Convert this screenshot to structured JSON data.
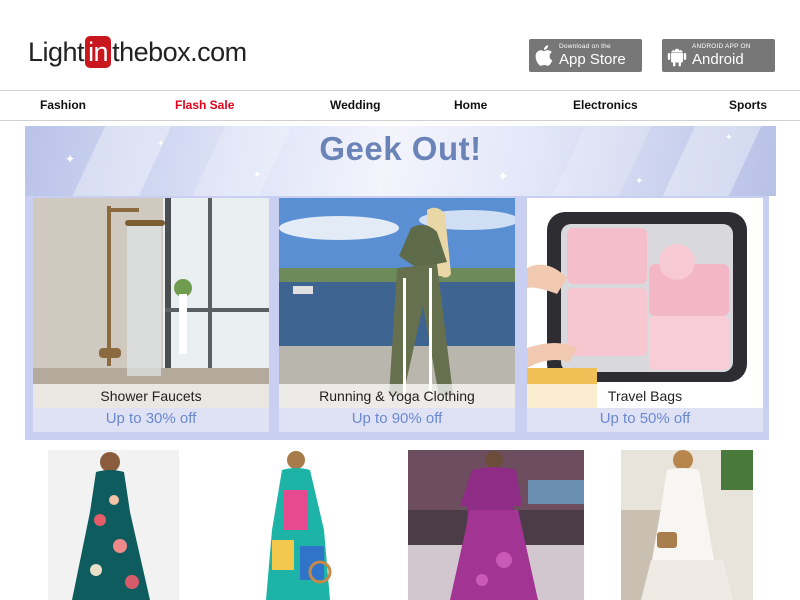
{
  "header": {
    "logo": {
      "pre": "Light",
      "mid": "in",
      "post": "thebox",
      "suffix": ".com"
    },
    "app_store": {
      "small": "Download on the",
      "big": "App Store",
      "icon": "apple-icon"
    },
    "android": {
      "small": "ANDROID APP ON",
      "big": "Android",
      "icon": "android-icon"
    }
  },
  "nav": {
    "items": [
      {
        "label": "Fashion"
      },
      {
        "label": "Flash Sale",
        "highlight": true
      },
      {
        "label": "Wedding"
      },
      {
        "label": "Home"
      },
      {
        "label": "Electronics"
      },
      {
        "label": "Sports"
      }
    ]
  },
  "banner": {
    "title": "Geek Out!"
  },
  "promos": [
    {
      "label": "Shower Faucets",
      "discount": "Up to 30% off"
    },
    {
      "label": "Running & Yoga Clothing",
      "discount": "Up to 90% off"
    },
    {
      "label": "Travel Bags",
      "discount": "Up to 50% off"
    }
  ],
  "colors": {
    "accent_red": "#e0001b",
    "logo_red": "#c8171e",
    "banner_title": "#6b84b8",
    "discount_text": "#6a89d0",
    "store_button": "#777777"
  }
}
